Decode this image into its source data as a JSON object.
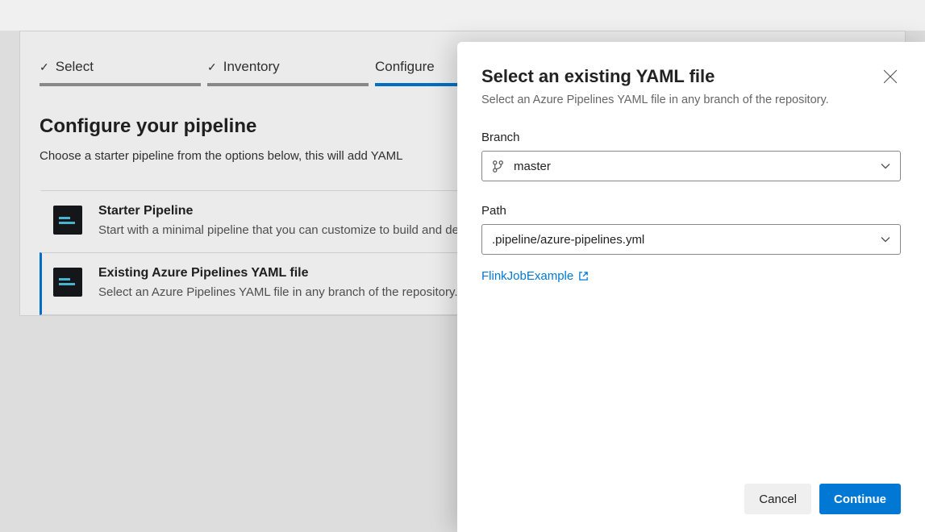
{
  "tabs": [
    {
      "label": "Select",
      "done": true
    },
    {
      "label": "Inventory",
      "done": true
    },
    {
      "label": "Configure",
      "done": false
    }
  ],
  "page": {
    "title": "Configure your pipeline",
    "subtitle": "Choose a starter pipeline from the options below, this will add YAML"
  },
  "options": [
    {
      "title": "Starter Pipeline",
      "desc": "Start with a minimal pipeline that you can customize to build and deploy your code."
    },
    {
      "title": "Existing Azure Pipelines YAML file",
      "desc": "Select an Azure Pipelines YAML file in any branch of the repository."
    }
  ],
  "panel": {
    "title": "Select an existing YAML file",
    "subtitle": "Select an Azure Pipelines YAML file in any branch of the repository.",
    "branch_label": "Branch",
    "branch_value": "master",
    "path_label": "Path",
    "path_value": ".pipeline/azure-pipelines.yml",
    "link_text": "FlinkJobExample",
    "cancel": "Cancel",
    "continue": "Continue"
  }
}
